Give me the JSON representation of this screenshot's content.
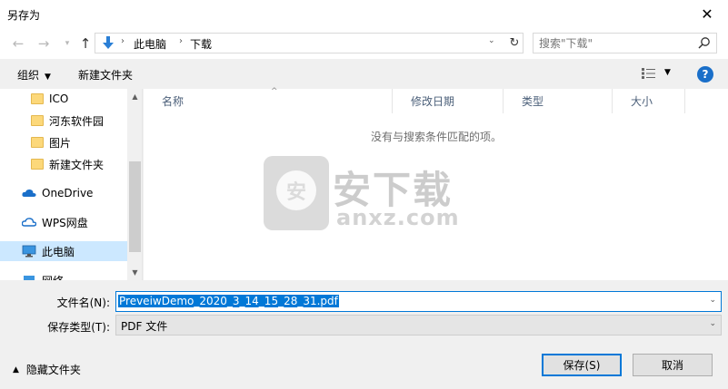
{
  "window": {
    "title": "另存为",
    "close_glyph": "✕"
  },
  "nav": {
    "back_glyph": "←",
    "forward_glyph": "→",
    "recent_glyph": "▾",
    "up_glyph": "↑",
    "breadcrumb": [
      "此电脑",
      "下载"
    ],
    "separator": "›",
    "refresh_glyph": "↻",
    "dropdown_glyph": "⌄",
    "search_placeholder": "搜索\"下载\""
  },
  "toolbar": {
    "organize_label": "组织",
    "new_folder_label": "新建文件夹",
    "caret": "▼",
    "help_label": "?"
  },
  "sidebar": {
    "items": [
      {
        "label": "ICO",
        "icon": "folder-icon"
      },
      {
        "label": "河东软件园",
        "icon": "folder-icon"
      },
      {
        "label": "图片",
        "icon": "folder-icon"
      },
      {
        "label": "新建文件夹",
        "icon": "folder-icon"
      },
      {
        "label": "OneDrive",
        "icon": "cloud-icon"
      },
      {
        "label": "WPS网盘",
        "icon": "wps-cloud-icon"
      },
      {
        "label": "此电脑",
        "icon": "computer-icon"
      },
      {
        "label": "网络",
        "icon": "network-icon"
      }
    ],
    "scroll_up": "▲",
    "scroll_down": "▼"
  },
  "file_list": {
    "columns": [
      "名称",
      "修改日期",
      "类型",
      "大小"
    ],
    "sort_glyph": "^",
    "empty_message": "没有与搜索条件匹配的项。"
  },
  "watermark": {
    "shield_text": "安",
    "cn": "安下载",
    "en": "anxz.com"
  },
  "form": {
    "filename_label": "文件名(N):",
    "filename_value": "PreveiwDemo_2020_3_14_15_28_31.pdf",
    "filetype_label": "保存类型(T):",
    "filetype_value": "PDF 文件",
    "dropdown_glyph": "⌄",
    "hide_folders_label": "隐藏文件夹",
    "hide_glyph": "▲",
    "save_label": "保存(S)",
    "cancel_label": "取消"
  },
  "colors": {
    "accent": "#0078d7",
    "selected": "#cce8ff",
    "help": "#1a6fc9",
    "folder": "#fcd87a"
  }
}
